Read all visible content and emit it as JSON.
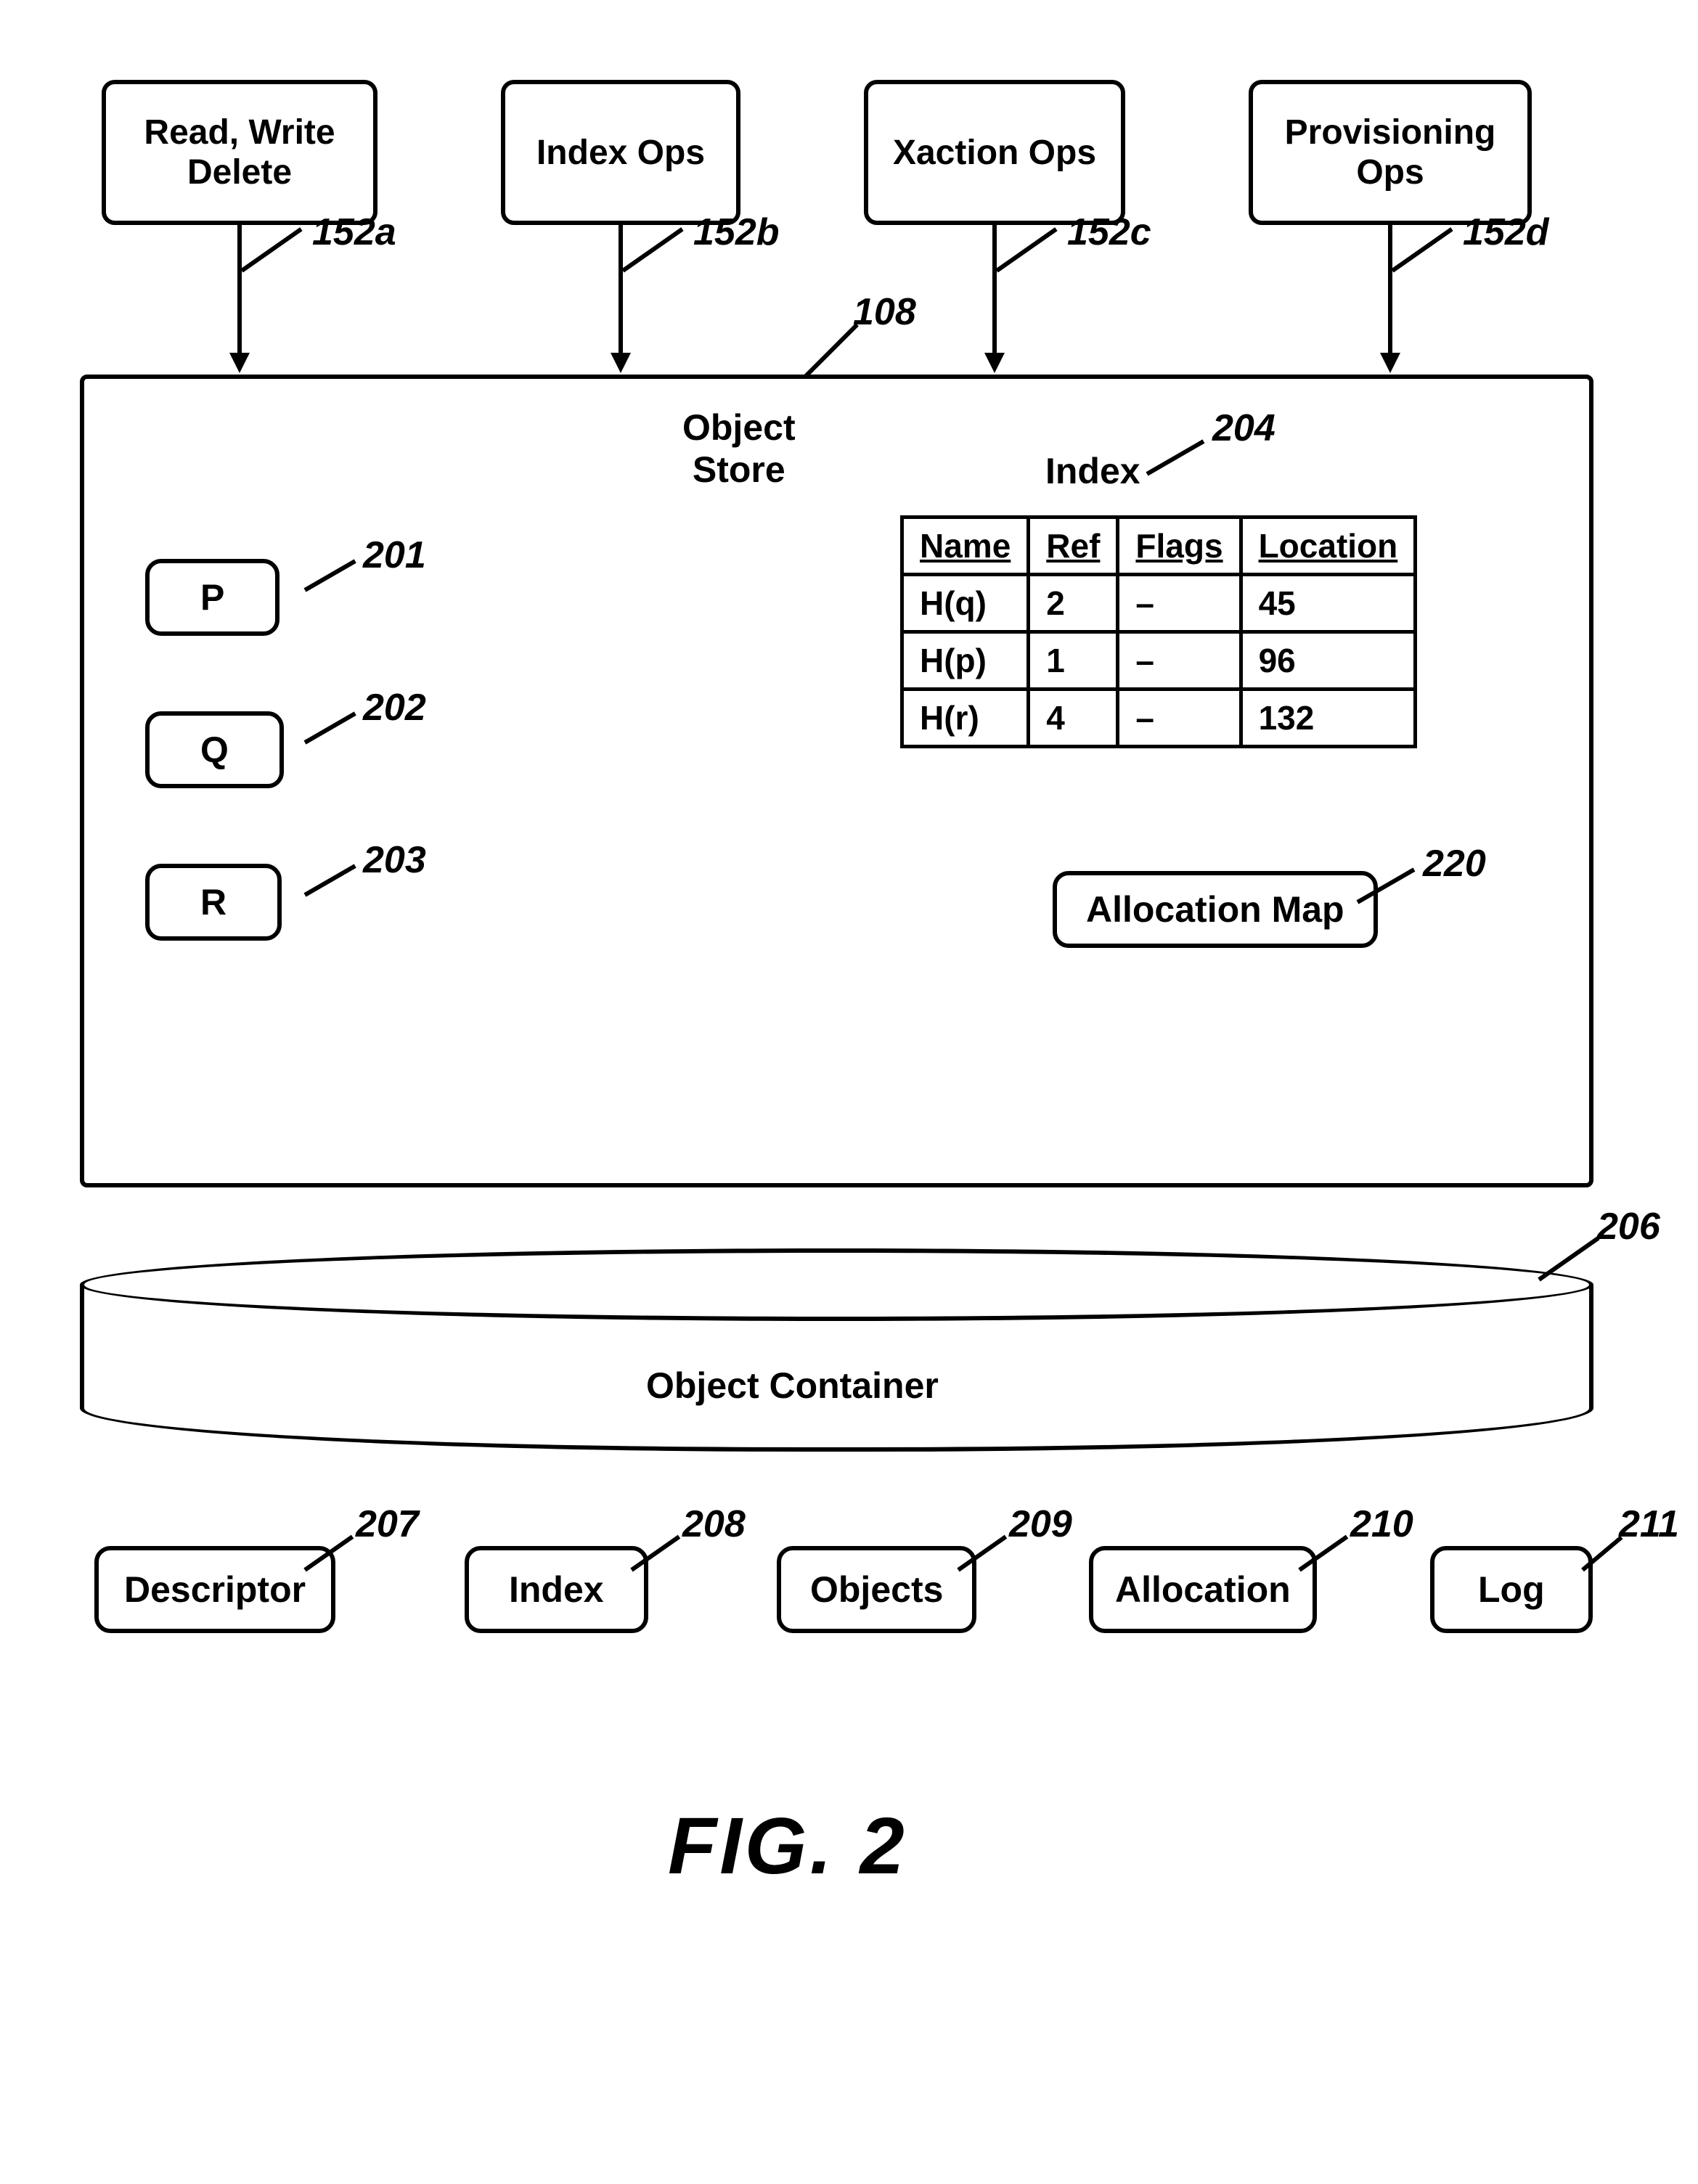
{
  "ops": {
    "rwd": "Read, Write\nDelete",
    "index": "Index Ops",
    "xaction": "Xaction Ops",
    "prov": "Provisioning\nOps"
  },
  "refs": {
    "r152a": "152a",
    "r152b": "152b",
    "r152c": "152c",
    "r152d": "152d",
    "r108": "108",
    "r201": "201",
    "r202": "202",
    "r203": "203",
    "r204": "204",
    "r220": "220",
    "r206": "206",
    "r207": "207",
    "r208": "208",
    "r209": "209",
    "r210": "210",
    "r211": "211"
  },
  "store": {
    "title": "Object\nStore",
    "p": "P",
    "q": "Q",
    "r": "R",
    "indexLabel": "Index",
    "allocMap": "Allocation Map",
    "table": {
      "headers": {
        "name": "Name",
        "ref": "Ref",
        "flags": "Flags",
        "loc": "Location"
      },
      "rows": [
        {
          "name": "H(q)",
          "ref": "2",
          "flags": "–",
          "loc": "45"
        },
        {
          "name": "H(p)",
          "ref": "1",
          "flags": "–",
          "loc": "96"
        },
        {
          "name": "H(r)",
          "ref": "4",
          "flags": "–",
          "loc": "132"
        }
      ]
    }
  },
  "container": {
    "title": "Object Container",
    "descriptor": "Descriptor",
    "index": "Index",
    "objects": "Objects",
    "allocation": "Allocation",
    "log": "Log"
  },
  "figure": "FIG.  2"
}
